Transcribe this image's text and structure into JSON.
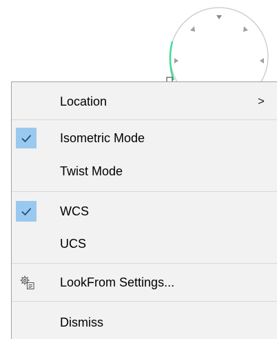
{
  "menu": {
    "location_label": "Location",
    "location_arrow": ">",
    "isometric_label": "Isometric Mode",
    "isometric_checked": true,
    "twist_label": "Twist Mode",
    "wcs_label": "WCS",
    "wcs_checked": true,
    "ucs_label": "UCS",
    "lookfrom_settings_label": "LookFrom Settings...",
    "lookfrom_settings_icon": "settings-gear-icon",
    "dismiss_label": "Dismiss"
  },
  "colors": {
    "menu_background": "#f2f2f2",
    "check_highlight": "#99c9ef",
    "check_mark": "#1e4f7a",
    "widget_circle": "#cfcfcf",
    "widget_accent": "#3ddc97"
  }
}
